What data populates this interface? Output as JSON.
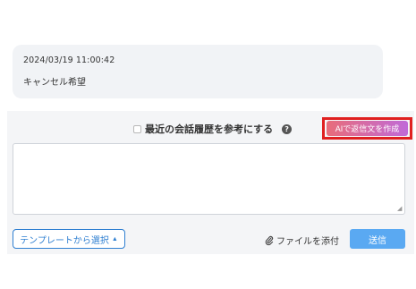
{
  "message": {
    "timestamp": "2024/03/19 11:00:42",
    "text": "キャンセル希望"
  },
  "reply": {
    "history_checkbox_label": "最近の会話履歴を参考にする",
    "history_checked": false,
    "help_icon": "question-circle-icon",
    "ai_button_label": "AIで返信文を作成",
    "textarea_value": "",
    "template_button_label": "テンプレートから選択",
    "attach_icon": "paperclip-icon",
    "attach_label": "ファイルを添付",
    "send_button_label": "送信"
  },
  "colors": {
    "highlight": "#e02020",
    "ai_gradient_start": "#e86c7a",
    "ai_gradient_end": "#c06ad8",
    "template_blue": "#2f7fd1",
    "send_blue": "#5aa9f2",
    "bubble_bg": "#f1f3f6",
    "panel_bg": "#f4f5f7"
  }
}
